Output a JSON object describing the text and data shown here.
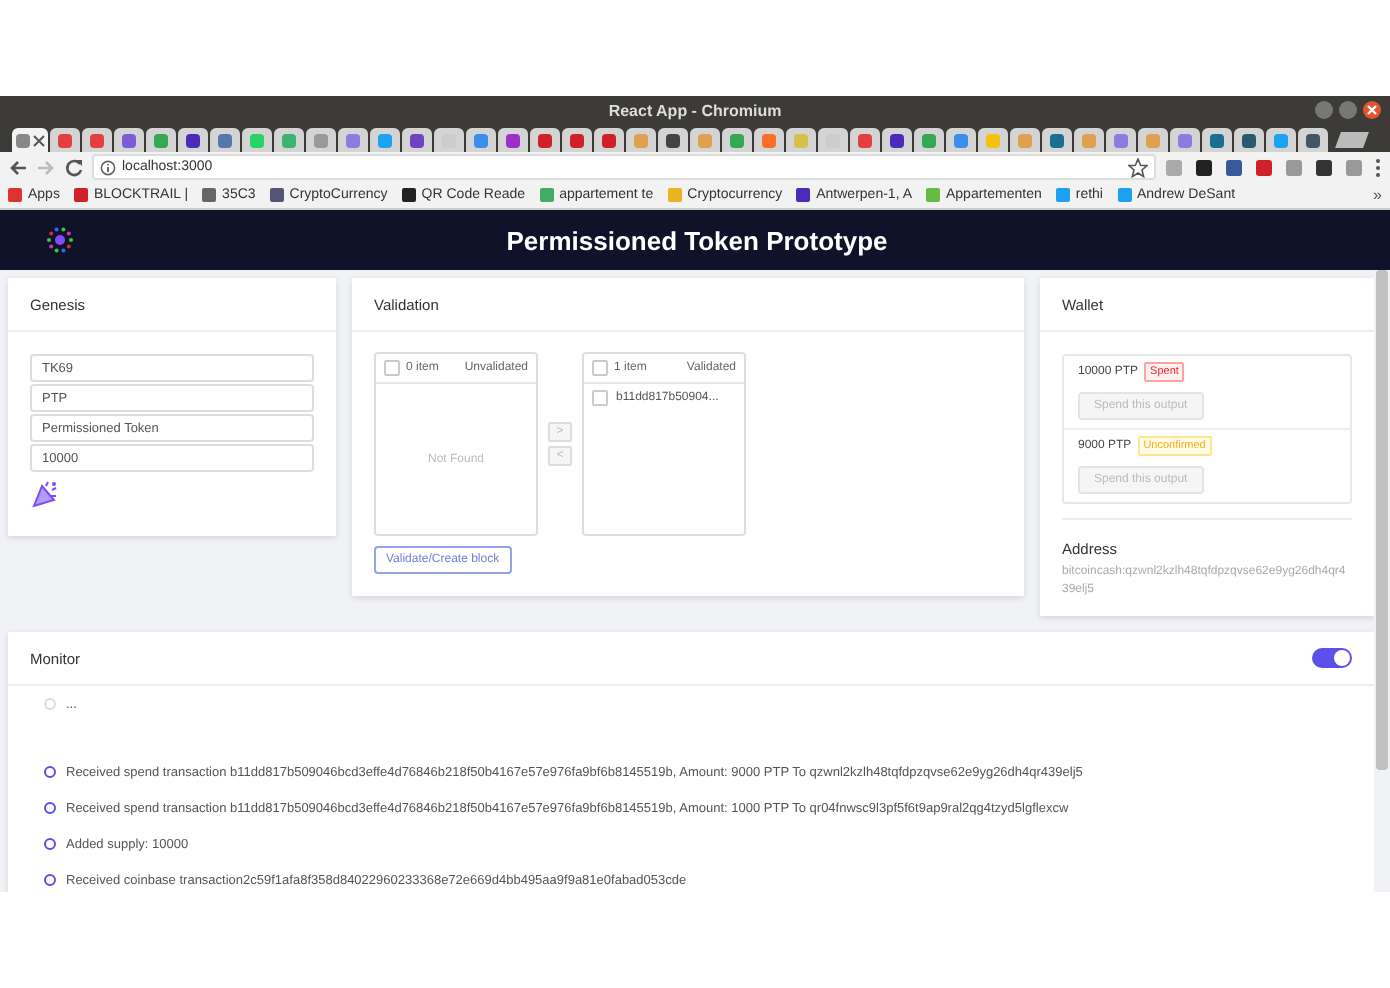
{
  "window": {
    "title": "React App - Chromium"
  },
  "browser_tabs": [
    {
      "color": "#888888",
      "selected": true
    },
    {
      "color": "#e04040",
      "selected": false
    },
    {
      "color": "#e04040",
      "selected": false
    },
    {
      "color": "#7b5cd6",
      "selected": false
    },
    {
      "color": "#34a853",
      "selected": false
    },
    {
      "color": "#4b2bb8",
      "selected": false
    },
    {
      "color": "#5577aa",
      "selected": false
    },
    {
      "color": "#25d366",
      "selected": false
    },
    {
      "color": "#3cb371",
      "selected": false
    },
    {
      "color": "#999999",
      "selected": false
    },
    {
      "color": "#8a7de0",
      "selected": false
    },
    {
      "color": "#1da1f2",
      "selected": false
    },
    {
      "color": "#6f42c1",
      "selected": false
    },
    {
      "color": "#cccccc",
      "selected": false
    },
    {
      "color": "#3b8eea",
      "selected": false
    },
    {
      "color": "#9b30c8",
      "selected": false
    },
    {
      "color": "#d0202a",
      "selected": false
    },
    {
      "color": "#d0202a",
      "selected": false
    },
    {
      "color": "#d0202a",
      "selected": false
    },
    {
      "color": "#e0a050",
      "selected": false
    },
    {
      "color": "#444444",
      "selected": false
    },
    {
      "color": "#e0a050",
      "selected": false
    },
    {
      "color": "#34a853",
      "selected": false
    },
    {
      "color": "#fc6d26",
      "selected": false
    },
    {
      "color": "#d4c04a",
      "selected": false
    },
    {
      "color": "#cccccc",
      "selected": false
    },
    {
      "color": "#e04040",
      "selected": false
    },
    {
      "color": "#4b2bb8",
      "selected": false
    },
    {
      "color": "#34a853",
      "selected": false
    },
    {
      "color": "#3b8eea",
      "selected": false
    },
    {
      "color": "#f4c20d",
      "selected": false
    },
    {
      "color": "#e0a050",
      "selected": false
    },
    {
      "color": "#1a6e8e",
      "selected": false
    },
    {
      "color": "#e0a050",
      "selected": false
    },
    {
      "color": "#8a7de0",
      "selected": false
    },
    {
      "color": "#e0a050",
      "selected": false
    },
    {
      "color": "#8a7de0",
      "selected": false
    },
    {
      "color": "#1a6e8e",
      "selected": false
    },
    {
      "color": "#2a5a70",
      "selected": false
    },
    {
      "color": "#1da1f2",
      "selected": false
    },
    {
      "color": "#445566",
      "selected": false
    }
  ],
  "address_bar": {
    "url": "localhost:3000"
  },
  "bookmarks": [
    {
      "label": "Apps"
    },
    {
      "label": "BLOCKTRAIL |"
    },
    {
      "label": "35C3"
    },
    {
      "label": "CryptoCurrency"
    },
    {
      "label": "QR Code Reade"
    },
    {
      "label": "appartement te"
    },
    {
      "label": "Cryptocurrency"
    },
    {
      "label": "Antwerpen-1, A"
    },
    {
      "label": "Appartementen"
    },
    {
      "label": "rethi"
    },
    {
      "label": "Andrew DeSant"
    }
  ],
  "bookmarks_more": "»",
  "app_header": {
    "title": "Permissioned Token Prototype"
  },
  "genesis": {
    "title": "Genesis",
    "fields": [
      "TK69",
      "PTP",
      "Permissioned Token",
      "10000"
    ]
  },
  "validation": {
    "title": "Validation",
    "left_list": {
      "count": "0 item",
      "title": "Unvalidated",
      "empty": "Not Found",
      "checked": false
    },
    "right_list": {
      "count": "1 item",
      "title": "Validated",
      "checked": false,
      "items": [
        {
          "label": "b11dd817b50904...",
          "checked": false
        }
      ]
    },
    "move_right": {
      "label": ">",
      "disabled": true
    },
    "move_left": {
      "label": "<",
      "disabled": true
    },
    "button": "Validate/Create block"
  },
  "wallet": {
    "title": "Wallet",
    "outputs": [
      {
        "amount": "10000 PTP",
        "tag": {
          "text": "Spent",
          "kind": "spent"
        },
        "button": "Spend this output",
        "disabled": true
      },
      {
        "amount": "9000 PTP",
        "tag": {
          "text": "Unconfirmed",
          "kind": "unconfirmed"
        },
        "button": "Spend this output",
        "disabled": true
      }
    ],
    "address_title": "Address",
    "address": "bitcoincash:qzwnl2kzlh48tqfdpzqvse62e9yg26dh4qr439elj5"
  },
  "monitor": {
    "title": "Monitor",
    "on": true,
    "log": [
      {
        "kind": "pending",
        "text": "..."
      },
      {
        "kind": "event",
        "text": "Received spend transaction b11dd817b509046bcd3effe4d76846b218f50b4167e57e976fa9bf6b8145519b, Amount: 9000 PTP To qzwnl2kzlh48tqfdpzqvse62e9yg26dh4qr439elj5"
      },
      {
        "kind": "event",
        "text": "Received spend transaction b11dd817b509046bcd3effe4d76846b218f50b4167e57e976fa9bf6b8145519b, Amount: 1000 PTP To qr04fnwsc9l3pf5f6t9ap9ral2qg4tzyd5lgflexcw"
      },
      {
        "kind": "event",
        "text": "Added supply: 10000"
      },
      {
        "kind": "event",
        "text": "Received coinbase transaction2c59f1afa8f358d84022960233368e72e669d4bb495aa9f9a81e0fabad053cde"
      }
    ]
  }
}
